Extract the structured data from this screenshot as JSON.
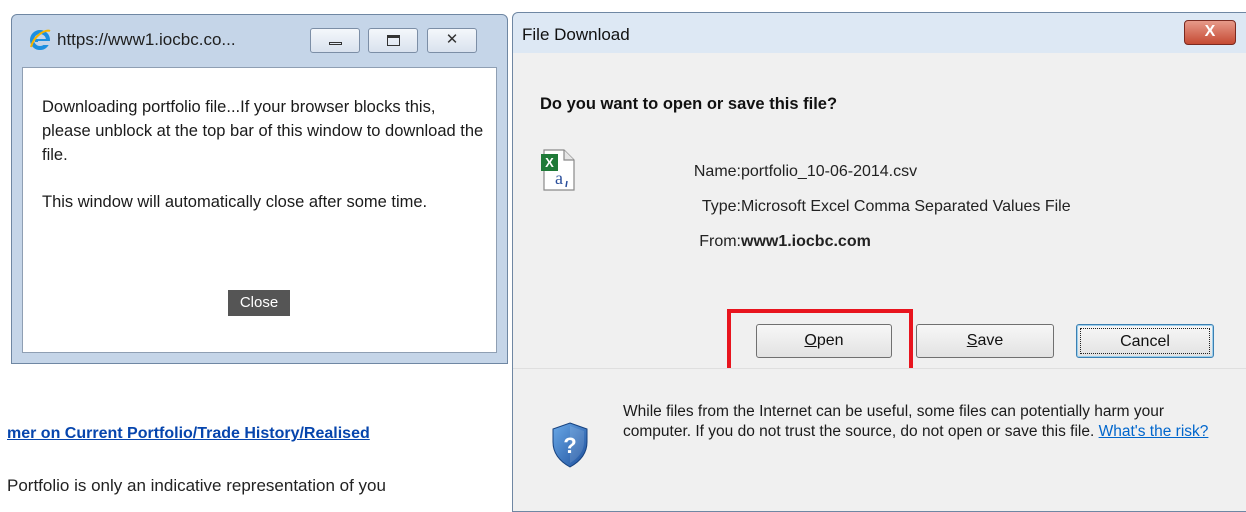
{
  "background": {
    "link_text": "mer on Current Portfolio/Trade History/Realised",
    "body_text": "Portfolio is only an indicative representation of you"
  },
  "popup": {
    "title_url": "https://www1.iocbc.co...",
    "message_1": "Downloading portfolio file...If your browser blocks this, please unblock at the top bar of this window to download the file.",
    "message_2": "This window will automatically close after some time.",
    "close_label": "Close",
    "icons": {
      "browser": "ie-logo-icon",
      "minimize": "minimize-icon",
      "maximize": "maximize-icon",
      "close": "close-icon"
    }
  },
  "dialog": {
    "title": "File Download",
    "close_glyph": "X",
    "question": "Do you want to open or save this file?",
    "file": {
      "name_label": "Name:",
      "name": "portfolio_10-06-2014.csv",
      "type_label": "Type:",
      "type": "Microsoft Excel Comma Separated Values File",
      "from_label": "From:",
      "from": "www1.iocbc.com"
    },
    "buttons": {
      "open": {
        "first": "O",
        "rest": "pen"
      },
      "save": {
        "first": "S",
        "rest": "ave"
      },
      "cancel": "Cancel"
    },
    "warning_text": "While files from the Internet can be useful, some files can potentially harm your computer. If you do not trust the source, do not open or save this file.",
    "risk_link": "What's the risk?",
    "icons": {
      "file": "excel-csv-file-icon",
      "security": "security-shield-icon"
    },
    "highlight_color": "#e8141e"
  }
}
